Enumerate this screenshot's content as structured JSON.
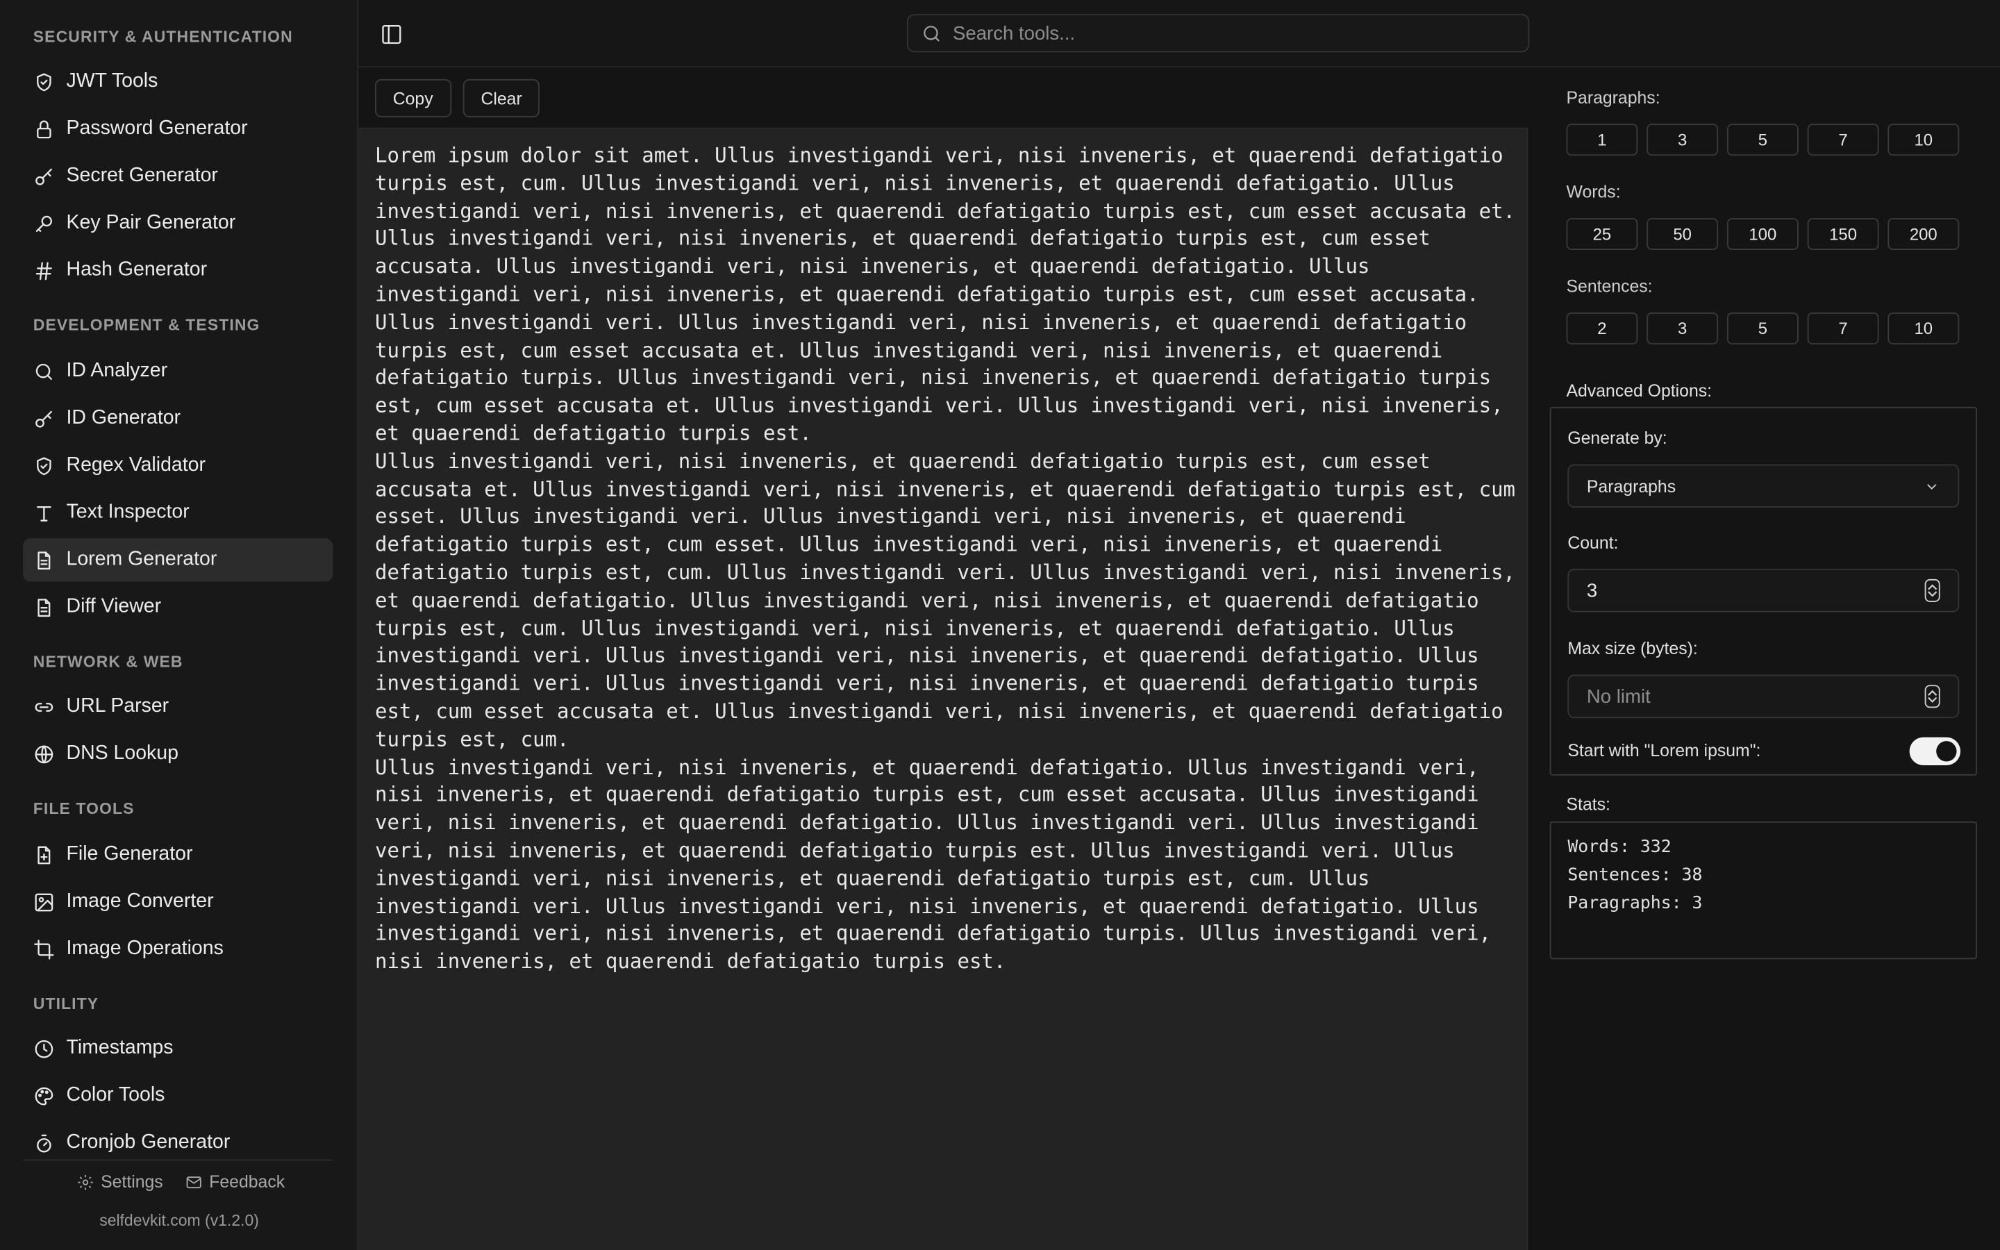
{
  "sidebar": {
    "sections": [
      {
        "title": "SECURITY & AUTHENTICATION",
        "items": [
          {
            "label": "JWT Tools",
            "icon": "shield-check-icon"
          },
          {
            "label": "Password Generator",
            "icon": "lock-icon"
          },
          {
            "label": "Secret Generator",
            "icon": "key-round-icon"
          },
          {
            "label": "Key Pair Generator",
            "icon": "key-icon"
          },
          {
            "label": "Hash Generator",
            "icon": "hash-icon"
          }
        ]
      },
      {
        "title": "DEVELOPMENT & TESTING",
        "items": [
          {
            "label": "ID Analyzer",
            "icon": "search-icon"
          },
          {
            "label": "ID Generator",
            "icon": "key-round-icon"
          },
          {
            "label": "Regex Validator",
            "icon": "shield-check-icon"
          },
          {
            "label": "Text Inspector",
            "icon": "type-icon"
          },
          {
            "label": "Lorem Generator",
            "icon": "file-text-icon"
          },
          {
            "label": "Diff Viewer",
            "icon": "file-text-icon"
          }
        ]
      },
      {
        "title": "NETWORK & WEB",
        "items": [
          {
            "label": "URL Parser",
            "icon": "link-icon"
          },
          {
            "label": "DNS Lookup",
            "icon": "globe-icon"
          }
        ]
      },
      {
        "title": "FILE TOOLS",
        "items": [
          {
            "label": "File Generator",
            "icon": "file-plus-icon"
          },
          {
            "label": "Image Converter",
            "icon": "image-icon"
          },
          {
            "label": "Image Operations",
            "icon": "crop-icon"
          }
        ]
      },
      {
        "title": "UTILITY",
        "items": [
          {
            "label": "Timestamps",
            "icon": "clock-icon"
          },
          {
            "label": "Color Tools",
            "icon": "palette-icon"
          },
          {
            "label": "Cronjob Generator",
            "icon": "timer-icon"
          }
        ]
      }
    ],
    "active_item": "Lorem Generator",
    "footer": {
      "settings_label": "Settings",
      "feedback_label": "Feedback",
      "version": "selfdevkit.com (v1.2.0)"
    }
  },
  "topbar": {
    "search_placeholder": "Search tools..."
  },
  "toolbar": {
    "copy_label": "Copy",
    "clear_label": "Clear"
  },
  "output": {
    "paragraphs": [
      "Lorem ipsum dolor sit amet. Ullus investigandi veri, nisi inveneris, et quaerendi defatigatio turpis est, cum. Ullus investigandi veri, nisi inveneris, et quaerendi defatigatio. Ullus investigandi veri, nisi inveneris, et quaerendi defatigatio turpis est, cum esset accusata et. Ullus investigandi veri, nisi inveneris, et quaerendi defatigatio turpis est, cum esset accusata. Ullus investigandi veri, nisi inveneris, et quaerendi defatigatio. Ullus investigandi veri, nisi inveneris, et quaerendi defatigatio turpis est, cum esset accusata. Ullus investigandi veri. Ullus investigandi veri, nisi inveneris, et quaerendi defatigatio turpis est, cum esset accusata et. Ullus investigandi veri, nisi inveneris, et quaerendi defatigatio turpis. Ullus investigandi veri, nisi inveneris, et quaerendi defatigatio turpis est, cum esset accusata et. Ullus investigandi veri. Ullus investigandi veri, nisi inveneris, et quaerendi defatigatio turpis est.",
      "Ullus investigandi veri, nisi inveneris, et quaerendi defatigatio turpis est, cum esset accusata et. Ullus investigandi veri, nisi inveneris, et quaerendi defatigatio turpis est, cum esset. Ullus investigandi veri. Ullus investigandi veri, nisi inveneris, et quaerendi defatigatio turpis est, cum esset. Ullus investigandi veri, nisi inveneris, et quaerendi defatigatio turpis est, cum. Ullus investigandi veri. Ullus investigandi veri, nisi inveneris, et quaerendi defatigatio. Ullus investigandi veri, nisi inveneris, et quaerendi defatigatio turpis est, cum. Ullus investigandi veri, nisi inveneris, et quaerendi defatigatio. Ullus investigandi veri. Ullus investigandi veri, nisi inveneris, et quaerendi defatigatio. Ullus investigandi veri. Ullus investigandi veri, nisi inveneris, et quaerendi defatigatio turpis est, cum esset accusata et. Ullus investigandi veri, nisi inveneris, et quaerendi defatigatio turpis est, cum.",
      "Ullus investigandi veri, nisi inveneris, et quaerendi defatigatio. Ullus investigandi veri, nisi inveneris, et quaerendi defatigatio turpis est, cum esset accusata. Ullus investigandi veri, nisi inveneris, et quaerendi defatigatio. Ullus investigandi veri. Ullus investigandi veri, nisi inveneris, et quaerendi defatigatio turpis est. Ullus investigandi veri. Ullus investigandi veri, nisi inveneris, et quaerendi defatigatio turpis est, cum. Ullus investigandi veri. Ullus investigandi veri, nisi inveneris, et quaerendi defatigatio. Ullus investigandi veri, nisi inveneris, et quaerendi defatigatio turpis. Ullus investigandi veri, nisi inveneris, et quaerendi defatigatio turpis est."
    ]
  },
  "options": {
    "paragraphs_label": "Paragraphs:",
    "paragraphs_presets": [
      "1",
      "3",
      "5",
      "7",
      "10"
    ],
    "words_label": "Words:",
    "words_presets": [
      "25",
      "50",
      "100",
      "150",
      "200"
    ],
    "sentences_label": "Sentences:",
    "sentences_presets": [
      "2",
      "3",
      "5",
      "7",
      "10"
    ],
    "advanced_label": "Advanced Options:",
    "generate_by_label": "Generate by:",
    "generate_by_value": "Paragraphs",
    "count_label": "Count:",
    "count_value": "3",
    "max_size_label": "Max size (bytes):",
    "max_size_placeholder": "No limit",
    "start_with_label": "Start with \"Lorem ipsum\":",
    "start_with_enabled": true
  },
  "stats": {
    "label": "Stats:",
    "lines": [
      "Words: 332",
      "Sentences: 38",
      "Paragraphs: 3"
    ]
  },
  "colors": {
    "background": "#111111",
    "sidebar": "#181818",
    "active_item": "#2c2c2c",
    "text": "#e6e6e6",
    "muted": "#9a9a9a",
    "border": "#3a3a3a"
  }
}
